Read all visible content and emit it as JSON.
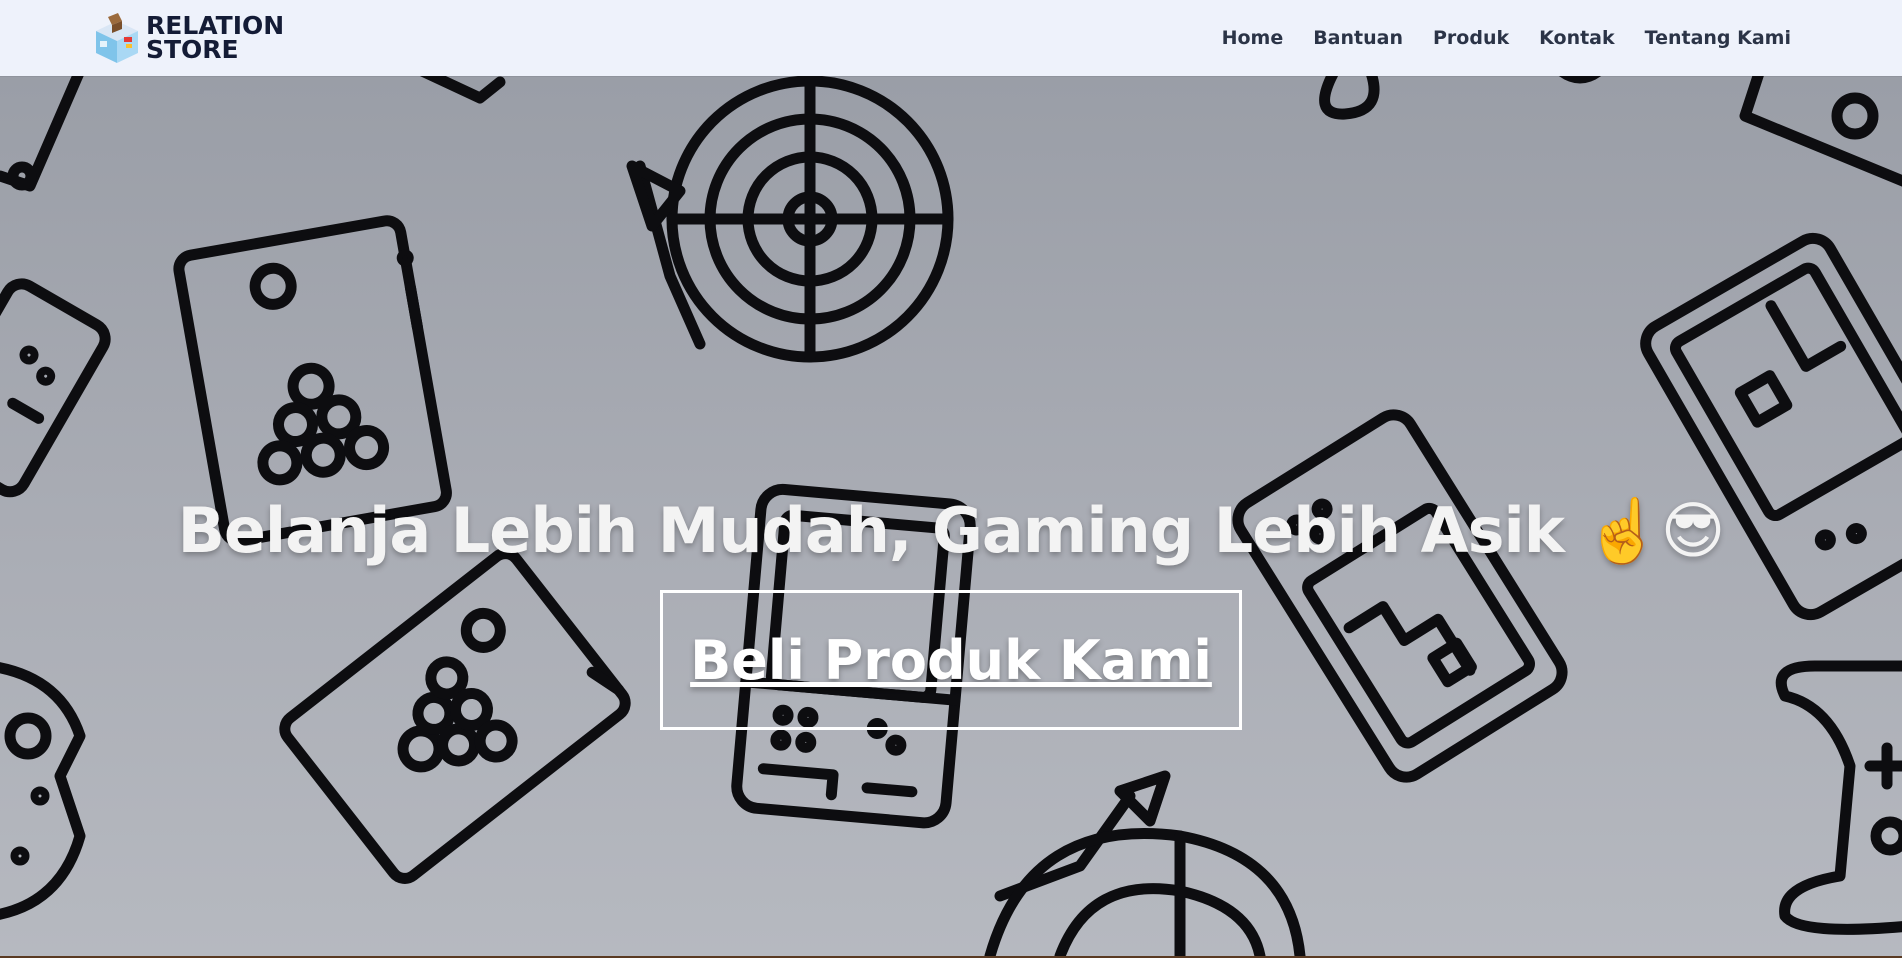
{
  "header": {
    "logo": {
      "line1": "RELATION",
      "line2": "STORE",
      "icon": "store-box-icon"
    },
    "nav": [
      {
        "label": "Home"
      },
      {
        "label": "Bantuan"
      },
      {
        "label": "Produk"
      },
      {
        "label": "Kontak"
      },
      {
        "label": "Tentang Kami"
      }
    ]
  },
  "hero": {
    "headline": "Belanja Lebih Mudah, Gaming Lebih Asik ☝️😎",
    "cta_label": "Beli Produk Kami",
    "background_icons": [
      "dartboard-icon",
      "billiard-table-icon",
      "handheld-console-icon",
      "gamepad-icon"
    ]
  },
  "colors": {
    "topbar_bg": "#eef2fb",
    "nav_text": "#2b3447",
    "hero_bg_top": "#9a9ea7",
    "hero_bg_bottom": "#b6b9c0",
    "icon_stroke": "#0d0d10",
    "headline": "#f3f3f3",
    "cta_border": "#ffffff"
  }
}
